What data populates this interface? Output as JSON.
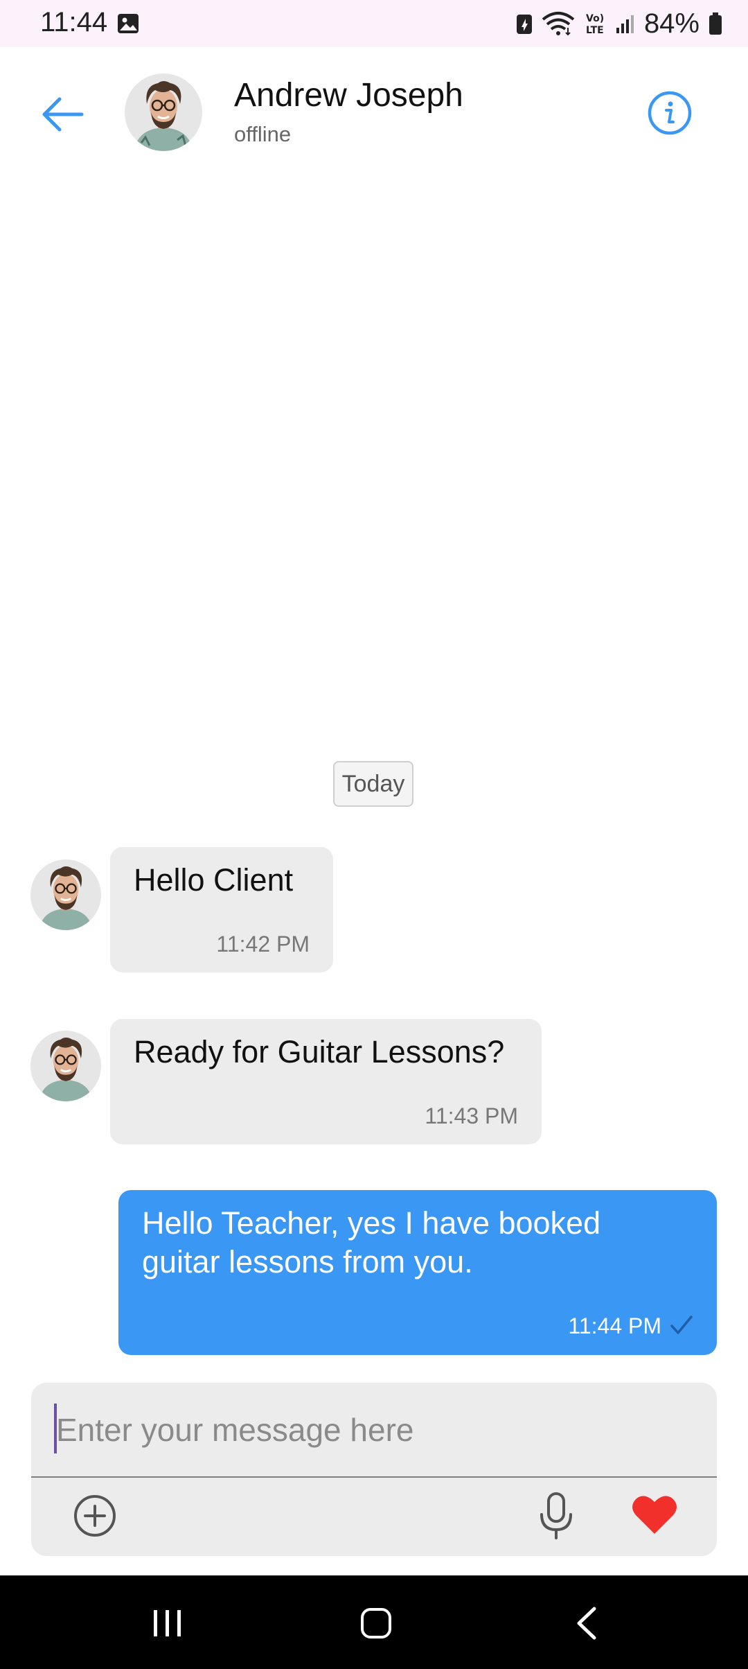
{
  "status_bar": {
    "time": "11:44",
    "battery_percent": "84%",
    "icons": [
      "gallery-icon",
      "data-saver-icon",
      "wifi-icon",
      "volte-icon",
      "signal-icon",
      "battery-icon"
    ]
  },
  "header": {
    "contact_name": "Andrew Joseph",
    "contact_status": "offline",
    "icons": [
      "back-arrow-icon",
      "info-icon"
    ],
    "accent_color": "#3a97f3"
  },
  "chat": {
    "date_separator": "Today",
    "messages": [
      {
        "direction": "incoming",
        "text": "Hello Client",
        "time": "11:42 PM"
      },
      {
        "direction": "incoming",
        "text": "Ready for Guitar Lessons?",
        "time": "11:43 PM"
      },
      {
        "direction": "outgoing",
        "text": "Hello Teacher, yes I have booked guitar lessons from you.",
        "time": "11:44 PM",
        "status_icon": "check-icon"
      }
    ]
  },
  "composer": {
    "placeholder": "Enter your message here",
    "value": "",
    "icons": [
      "add-circle-icon",
      "microphone-icon",
      "heart-icon"
    ],
    "heart_color": "#f2302b"
  },
  "nav_bar": {
    "icons": [
      "recent-apps-icon",
      "home-icon",
      "back-icon"
    ]
  },
  "colors": {
    "incoming_bubble": "#ececec",
    "outgoing_bubble": "#3a97f3",
    "status_bar_bg": "#fbf2fb"
  }
}
